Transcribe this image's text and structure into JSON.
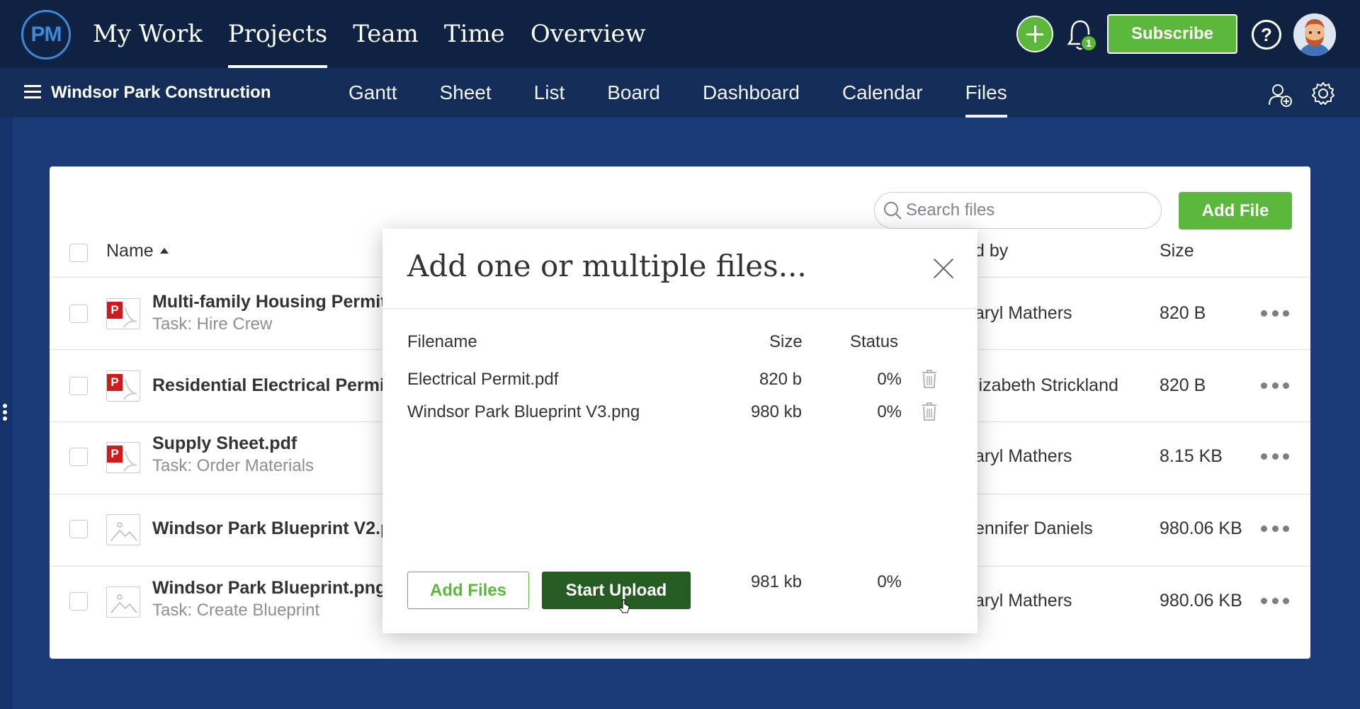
{
  "app": {
    "logo_text": "PM",
    "nav": [
      "My Work",
      "Projects",
      "Team",
      "Time",
      "Overview"
    ],
    "nav_active": "Projects",
    "notification_count": "1",
    "subscribe_label": "Subscribe",
    "help_label": "?"
  },
  "project": {
    "name": "Windsor Park Construction",
    "views": [
      "Gantt",
      "Sheet",
      "List",
      "Board",
      "Dashboard",
      "Calendar",
      "Files"
    ],
    "view_active": "Files"
  },
  "files": {
    "search_placeholder": "Search files",
    "add_file_label": "Add File",
    "columns": {
      "name": "Name",
      "uploaded_by": "d by",
      "size": "Size"
    },
    "rows": [
      {
        "name": "Multi-family Housing Permit.",
        "task": "Task: Hire Crew",
        "uploaded_by": "aryl Mathers",
        "size": "820 B",
        "type": "pdf"
      },
      {
        "name": "Residential Electrical Permit",
        "task": "",
        "uploaded_by": "lizabeth Strickland",
        "size": "820 B",
        "type": "pdf"
      },
      {
        "name": "Supply Sheet.pdf",
        "task": "Task: Order Materials",
        "uploaded_by": "aryl Mathers",
        "size": "8.15 KB",
        "type": "pdf"
      },
      {
        "name": "Windsor Park Blueprint V2.p",
        "task": "",
        "uploaded_by": "ennifer Daniels",
        "size": "980.06 KB",
        "type": "image"
      },
      {
        "name": "Windsor Park Blueprint.png",
        "task": "Task: Create Blueprint",
        "uploaded_by": "aryl Mathers",
        "size": "980.06 KB",
        "type": "image"
      }
    ],
    "pdf_badge": "P"
  },
  "modal": {
    "title": "Add one or multiple files...",
    "headers": {
      "filename": "Filename",
      "size": "Size",
      "status": "Status"
    },
    "files": [
      {
        "filename": "Electrical Permit.pdf",
        "size": "820 b",
        "status": "0%"
      },
      {
        "filename": "Windsor Park Blueprint V3.png",
        "size": "980 kb",
        "status": "0%"
      }
    ],
    "total_size": "981 kb",
    "total_status": "0%",
    "add_files_label": "Add Files",
    "start_upload_label": "Start Upload"
  },
  "colors": {
    "nav_bg": "#0f2242",
    "subnav_bg": "#132c58",
    "accent_green": "#5cb83a",
    "dark_green": "#245c22",
    "pdf_red": "#d11b1b"
  },
  "icons": [
    "plus-icon",
    "bell-icon",
    "help-icon",
    "avatar",
    "hamburger-icon",
    "add-user-icon",
    "gear-icon",
    "search-icon",
    "pdf-icon",
    "image-icon",
    "more-icon",
    "close-icon",
    "trash-icon",
    "cursor-icon"
  ]
}
